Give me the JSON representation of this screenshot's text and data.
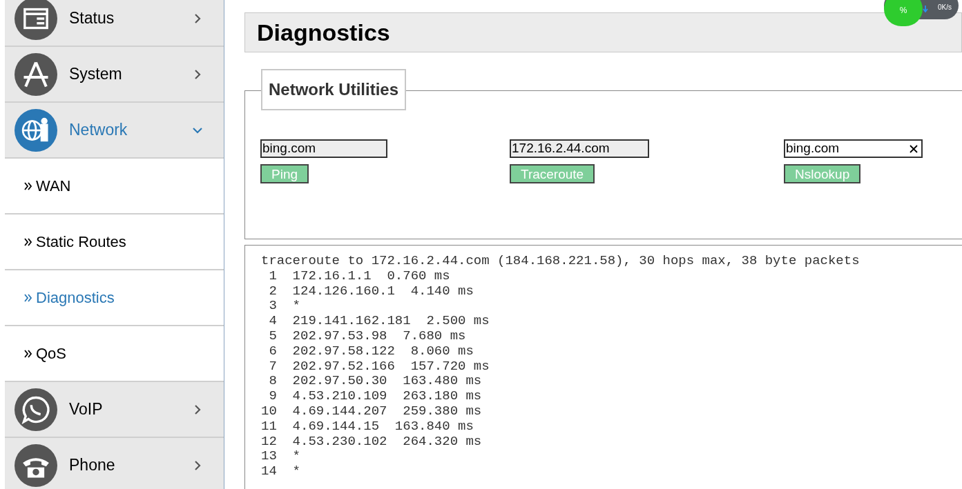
{
  "sidebar": {
    "items": [
      {
        "label": "Status",
        "expanded": false,
        "selected": false
      },
      {
        "label": "System",
        "expanded": false,
        "selected": false
      },
      {
        "label": "Network",
        "expanded": true,
        "selected": true,
        "children": [
          {
            "label": "WAN",
            "selected": false
          },
          {
            "label": "Static Routes",
            "selected": false
          },
          {
            "label": "Diagnostics",
            "selected": true
          },
          {
            "label": "QoS",
            "selected": false
          }
        ]
      },
      {
        "label": "VoIP",
        "expanded": false,
        "selected": false
      },
      {
        "label": "Phone",
        "expanded": false,
        "selected": false
      }
    ]
  },
  "speed_widget": {
    "percent": "%",
    "speed": "0K/s"
  },
  "page_title": "Diagnostics",
  "section": {
    "legend": "Network Utilities",
    "tools": [
      {
        "value": "bing.com",
        "button": "Ping",
        "focused": false
      },
      {
        "value": "172.16.2.44.com",
        "button": "Traceroute",
        "focused": false
      },
      {
        "value": "bing.com",
        "button": "Nslookup",
        "focused": true
      }
    ]
  },
  "output": {
    "lines": [
      "traceroute to 172.16.2.44.com (184.168.221.58), 30 hops max, 38 byte packets",
      " 1  172.16.1.1  0.760 ms",
      " 2  124.126.160.1  4.140 ms",
      " 3  *",
      " 4  219.141.162.181  2.500 ms",
      " 5  202.97.53.98  7.680 ms",
      " 6  202.97.58.122  8.060 ms",
      " 7  202.97.52.166  157.720 ms",
      " 8  202.97.50.30  163.480 ms",
      " 9  4.53.210.109  263.180 ms",
      "10  4.69.144.207  259.380 ms",
      "11  4.69.144.15  163.840 ms",
      "12  4.53.230.102  264.320 ms",
      "13  *",
      "14  *"
    ]
  }
}
